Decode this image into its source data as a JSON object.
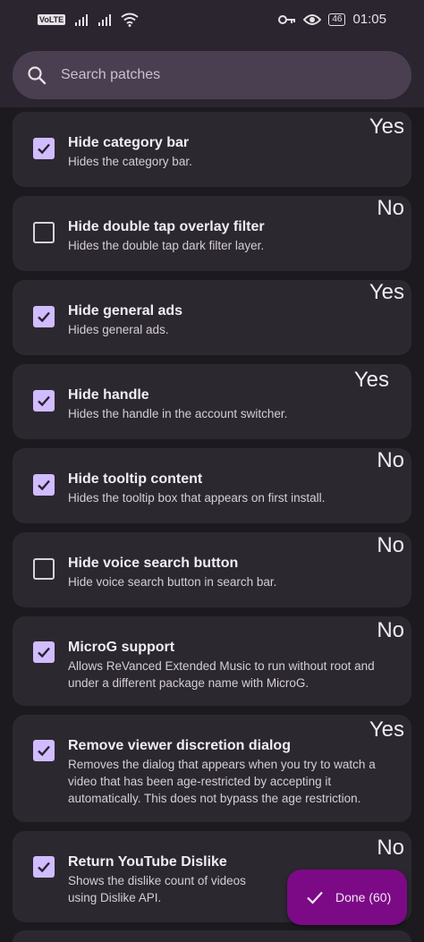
{
  "status_bar": {
    "volte": "VoLTE",
    "time": "01:05",
    "battery": "46"
  },
  "search": {
    "placeholder": "Search patches"
  },
  "patches": [
    {
      "title": "Hide category bar",
      "description": "Hides the category bar.",
      "checked": true,
      "annotation": "Yes"
    },
    {
      "title": "Hide double tap overlay filter",
      "description": "Hides the double tap dark filter layer.",
      "checked": false,
      "annotation": "No"
    },
    {
      "title": "Hide general ads",
      "description": "Hides general ads.",
      "checked": true,
      "annotation": "Yes"
    },
    {
      "title": "Hide handle",
      "description": "Hides the handle in the account switcher.",
      "checked": true,
      "annotation": "Yes"
    },
    {
      "title": "Hide tooltip content",
      "description": "Hides the tooltip box that appears on first install.",
      "checked": true,
      "annotation": "No"
    },
    {
      "title": "Hide voice search button",
      "description": "Hide voice search button in search bar.",
      "checked": false,
      "annotation": "No"
    },
    {
      "title": "MicroG support",
      "description": "Allows ReVanced Extended Music to run without root and under a different package name with MicroG.",
      "checked": true,
      "annotation": "No"
    },
    {
      "title": "Remove viewer discretion dialog",
      "description": "Removes the dialog that appears when you try to watch a video that has been age-restricted by accepting it automatically. This does not bypass the age restriction.",
      "checked": true,
      "annotation": "Yes"
    },
    {
      "title": "Return YouTube Dislike",
      "description": "Shows the dislike count of videos using Dislike API.",
      "checked": true,
      "annotation": "No"
    }
  ],
  "fab": {
    "label": "Done (60)"
  },
  "colors": {
    "accent": "#d0bcff",
    "fab": "#7c0a86",
    "card": "#2c2830",
    "background": "#1c1a1f"
  }
}
